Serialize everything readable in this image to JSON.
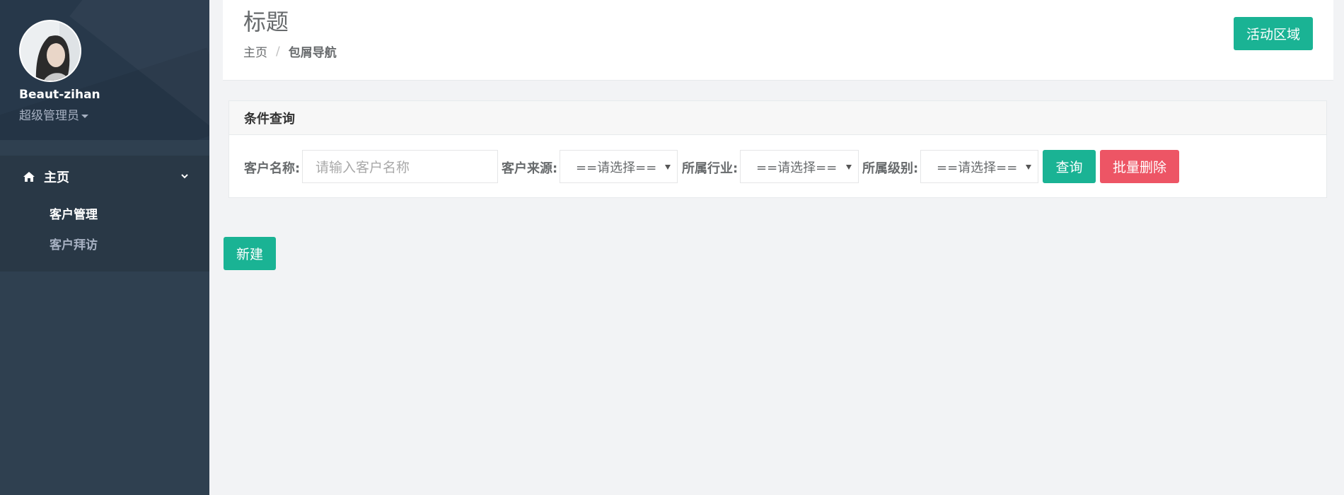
{
  "user": {
    "name": "Beaut-zihan",
    "role": "超级管理员"
  },
  "nav": {
    "home_label": "主页",
    "items": [
      {
        "label": "客户管理",
        "active": true
      },
      {
        "label": "客户拜访",
        "active": false
      }
    ]
  },
  "header": {
    "title": "标题",
    "breadcrumb_home": "主页",
    "breadcrumb_sep": "/",
    "breadcrumb_current": "包屑导航",
    "active_area_label": "活动区域"
  },
  "query": {
    "panel_title": "条件查询",
    "name_label": "客户名称:",
    "name_placeholder": "请输入客户名称",
    "source_label": "客户来源:",
    "source_value": "==请选择==",
    "industry_label": "所属行业:",
    "industry_value": "==请选择==",
    "level_label": "所属级别:",
    "level_value": "==请选择==",
    "search_label": "查询",
    "batch_delete_label": "批量删除"
  },
  "actions": {
    "new_label": "新建"
  },
  "colors": {
    "primary": "#1ab394",
    "danger": "#ed5565",
    "sidebar": "#2f4050"
  },
  "icons": {
    "home": "home-icon",
    "chevron": "chevron-down-icon",
    "caret": "caret-down-icon"
  }
}
